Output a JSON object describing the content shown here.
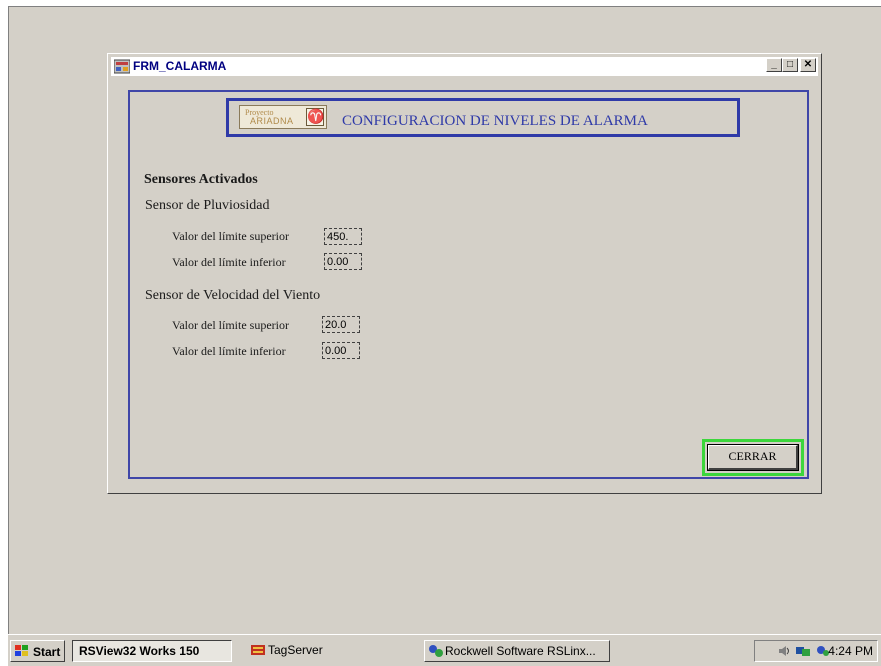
{
  "window": {
    "title": "FRM_CALARMA",
    "minimize_glyph": "_",
    "maximize_glyph": "□",
    "close_glyph": "✕"
  },
  "header": {
    "logo_line1": "Proyecto",
    "logo_line2": "ARIADNA",
    "logo_mark": "♈",
    "title": "CONFIGURACION DE NIVELES DE ALARMA"
  },
  "content": {
    "section_title": "Sensores Activados",
    "sensors": [
      {
        "name": "Sensor de Pluviosidad",
        "upper_label": "Valor del límite superior",
        "upper_value": "450.",
        "lower_label": "Valor del límite inferior",
        "lower_value": "0.00"
      },
      {
        "name": "Sensor de Velocidad del Viento",
        "upper_label": "Valor del límite superior",
        "upper_value": "20.0",
        "lower_label": "Valor del límite inferior",
        "lower_value": "0.00"
      }
    ],
    "close_button": "CERRAR"
  },
  "taskbar": {
    "start_label": "Start",
    "tasks": [
      {
        "label": "RSView32 Works 150",
        "active": true
      },
      {
        "label": "TagServer",
        "active": false
      },
      {
        "label": "Rockwell Software RSLinx...",
        "active": false
      }
    ],
    "clock": "4:24 PM"
  },
  "colors": {
    "accent_blue": "#2f3aa8",
    "highlight_green": "#3cd63c",
    "window_face": "#d4d0c8"
  }
}
